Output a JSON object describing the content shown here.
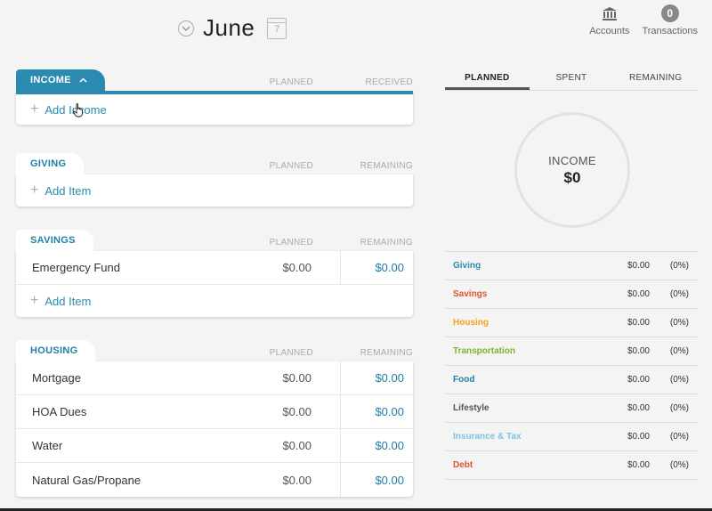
{
  "header": {
    "month": "June",
    "calendar_day": "7",
    "accounts_label": "Accounts",
    "transactions_label": "Transactions",
    "transactions_count": "0"
  },
  "income": {
    "label": "INCOME",
    "col_planned": "PLANNED",
    "col_received": "RECEIVED",
    "add_label": "Add Income"
  },
  "giving": {
    "label": "GIVING",
    "col_planned": "PLANNED",
    "col_remaining": "REMAINING",
    "add_label": "Add Item"
  },
  "savings": {
    "label": "SAVINGS",
    "col_planned": "PLANNED",
    "col_remaining": "REMAINING",
    "items": [
      {
        "name": "Emergency Fund",
        "planned": "$0.00",
        "remaining": "$0.00"
      }
    ],
    "add_label": "Add Item"
  },
  "housing": {
    "label": "HOUSING",
    "col_planned": "PLANNED",
    "col_remaining": "REMAINING",
    "items": [
      {
        "name": "Mortgage",
        "planned": "$0.00",
        "remaining": "$0.00"
      },
      {
        "name": "HOA Dues",
        "planned": "$0.00",
        "remaining": "$0.00"
      },
      {
        "name": "Water",
        "planned": "$0.00",
        "remaining": "$0.00"
      },
      {
        "name": "Natural Gas/Propane",
        "planned": "$0.00",
        "remaining": "$0.00"
      }
    ]
  },
  "summary": {
    "tabs": [
      "PLANNED",
      "SPENT",
      "REMAINING"
    ],
    "donut_label": "INCOME",
    "donut_value": "$0",
    "categories": [
      {
        "name": "Giving",
        "amount": "$0.00",
        "pct": "(0%)",
        "color": "#2a8ab0"
      },
      {
        "name": "Savings",
        "amount": "$0.00",
        "pct": "(0%)",
        "color": "#e0542e"
      },
      {
        "name": "Housing",
        "amount": "$0.00",
        "pct": "(0%)",
        "color": "#f2a31c"
      },
      {
        "name": "Transportation",
        "amount": "$0.00",
        "pct": "(0%)",
        "color": "#7ab42a"
      },
      {
        "name": "Food",
        "amount": "$0.00",
        "pct": "(0%)",
        "color": "#1e7fa6"
      },
      {
        "name": "Lifestyle",
        "amount": "$0.00",
        "pct": "(0%)",
        "color": "#555555"
      },
      {
        "name": "Insurance & Tax",
        "amount": "$0.00",
        "pct": "(0%)",
        "color": "#7ec3df"
      },
      {
        "name": "Debt",
        "amount": "$0.00",
        "pct": "(0%)",
        "color": "#e0542e"
      }
    ]
  }
}
